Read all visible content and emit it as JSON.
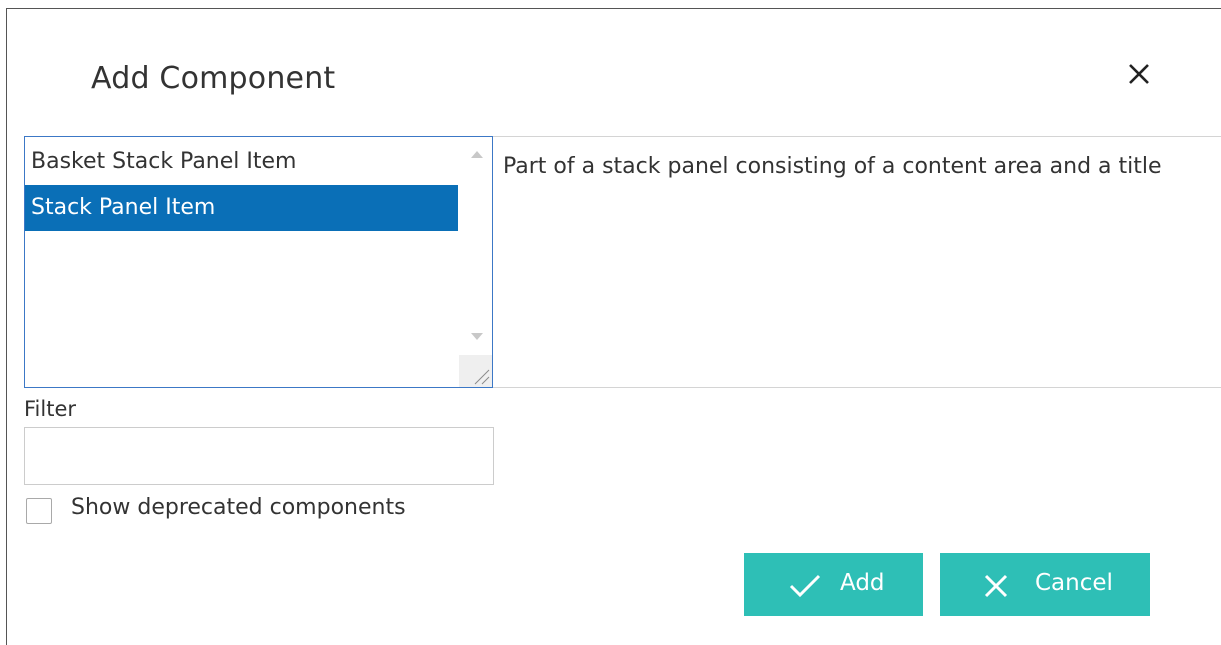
{
  "dialog": {
    "title": "Add Component",
    "close_icon": "close-icon"
  },
  "component_list": {
    "items": [
      {
        "label": "Basket Stack Panel Item",
        "selected": false
      },
      {
        "label": "Stack Panel Item",
        "selected": true
      }
    ]
  },
  "description": {
    "text": "Part of a stack panel consisting of a content area and a title"
  },
  "filter": {
    "label": "Filter",
    "value": "",
    "placeholder": ""
  },
  "deprecated_checkbox": {
    "label": "Show deprecated components",
    "checked": false
  },
  "buttons": {
    "add_label": "Add",
    "add_icon": "checkmark-icon",
    "cancel_label": "Cancel",
    "cancel_icon": "x-icon"
  },
  "colors": {
    "accent": "#2ebfb6",
    "selection": "#0a6fb7",
    "focus_border": "#3c78c6"
  }
}
